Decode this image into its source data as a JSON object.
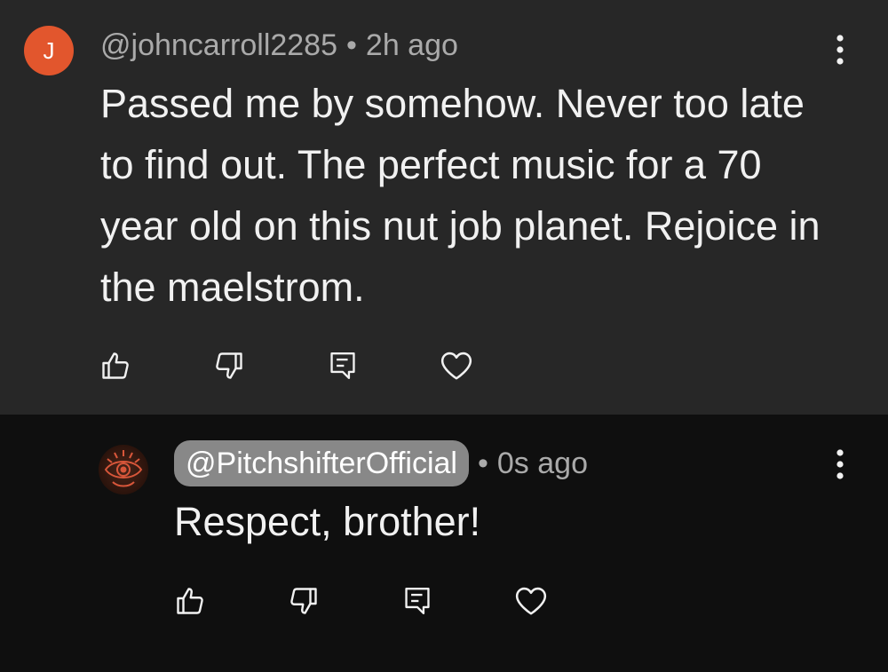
{
  "comments": [
    {
      "avatar_letter": "J",
      "avatar_color": "#e2562d",
      "author": "@johncarroll2285",
      "separator": "•",
      "time": "2h ago",
      "text": "Passed me by somehow. Never too late to find out. The perfect music for a 70 year old on this nut job planet. Rejoice in the maelstrom.",
      "actions": [
        "like-icon",
        "dislike-icon",
        "reply-icon",
        "heart-icon"
      ]
    },
    {
      "avatar": "eye-emblem-avatar",
      "author": "@PitchshifterOfficial",
      "author_badge_color": "#888888",
      "separator": "•",
      "time": "0s ago",
      "text": "Respect, brother!",
      "actions": [
        "like-icon",
        "dislike-icon",
        "reply-icon",
        "heart-icon"
      ]
    }
  ],
  "colors": {
    "parent_background": "#272727",
    "reply_background": "#0f0f0f",
    "meta_text": "#aaaaaa",
    "body_text": "#f1f1f1"
  }
}
